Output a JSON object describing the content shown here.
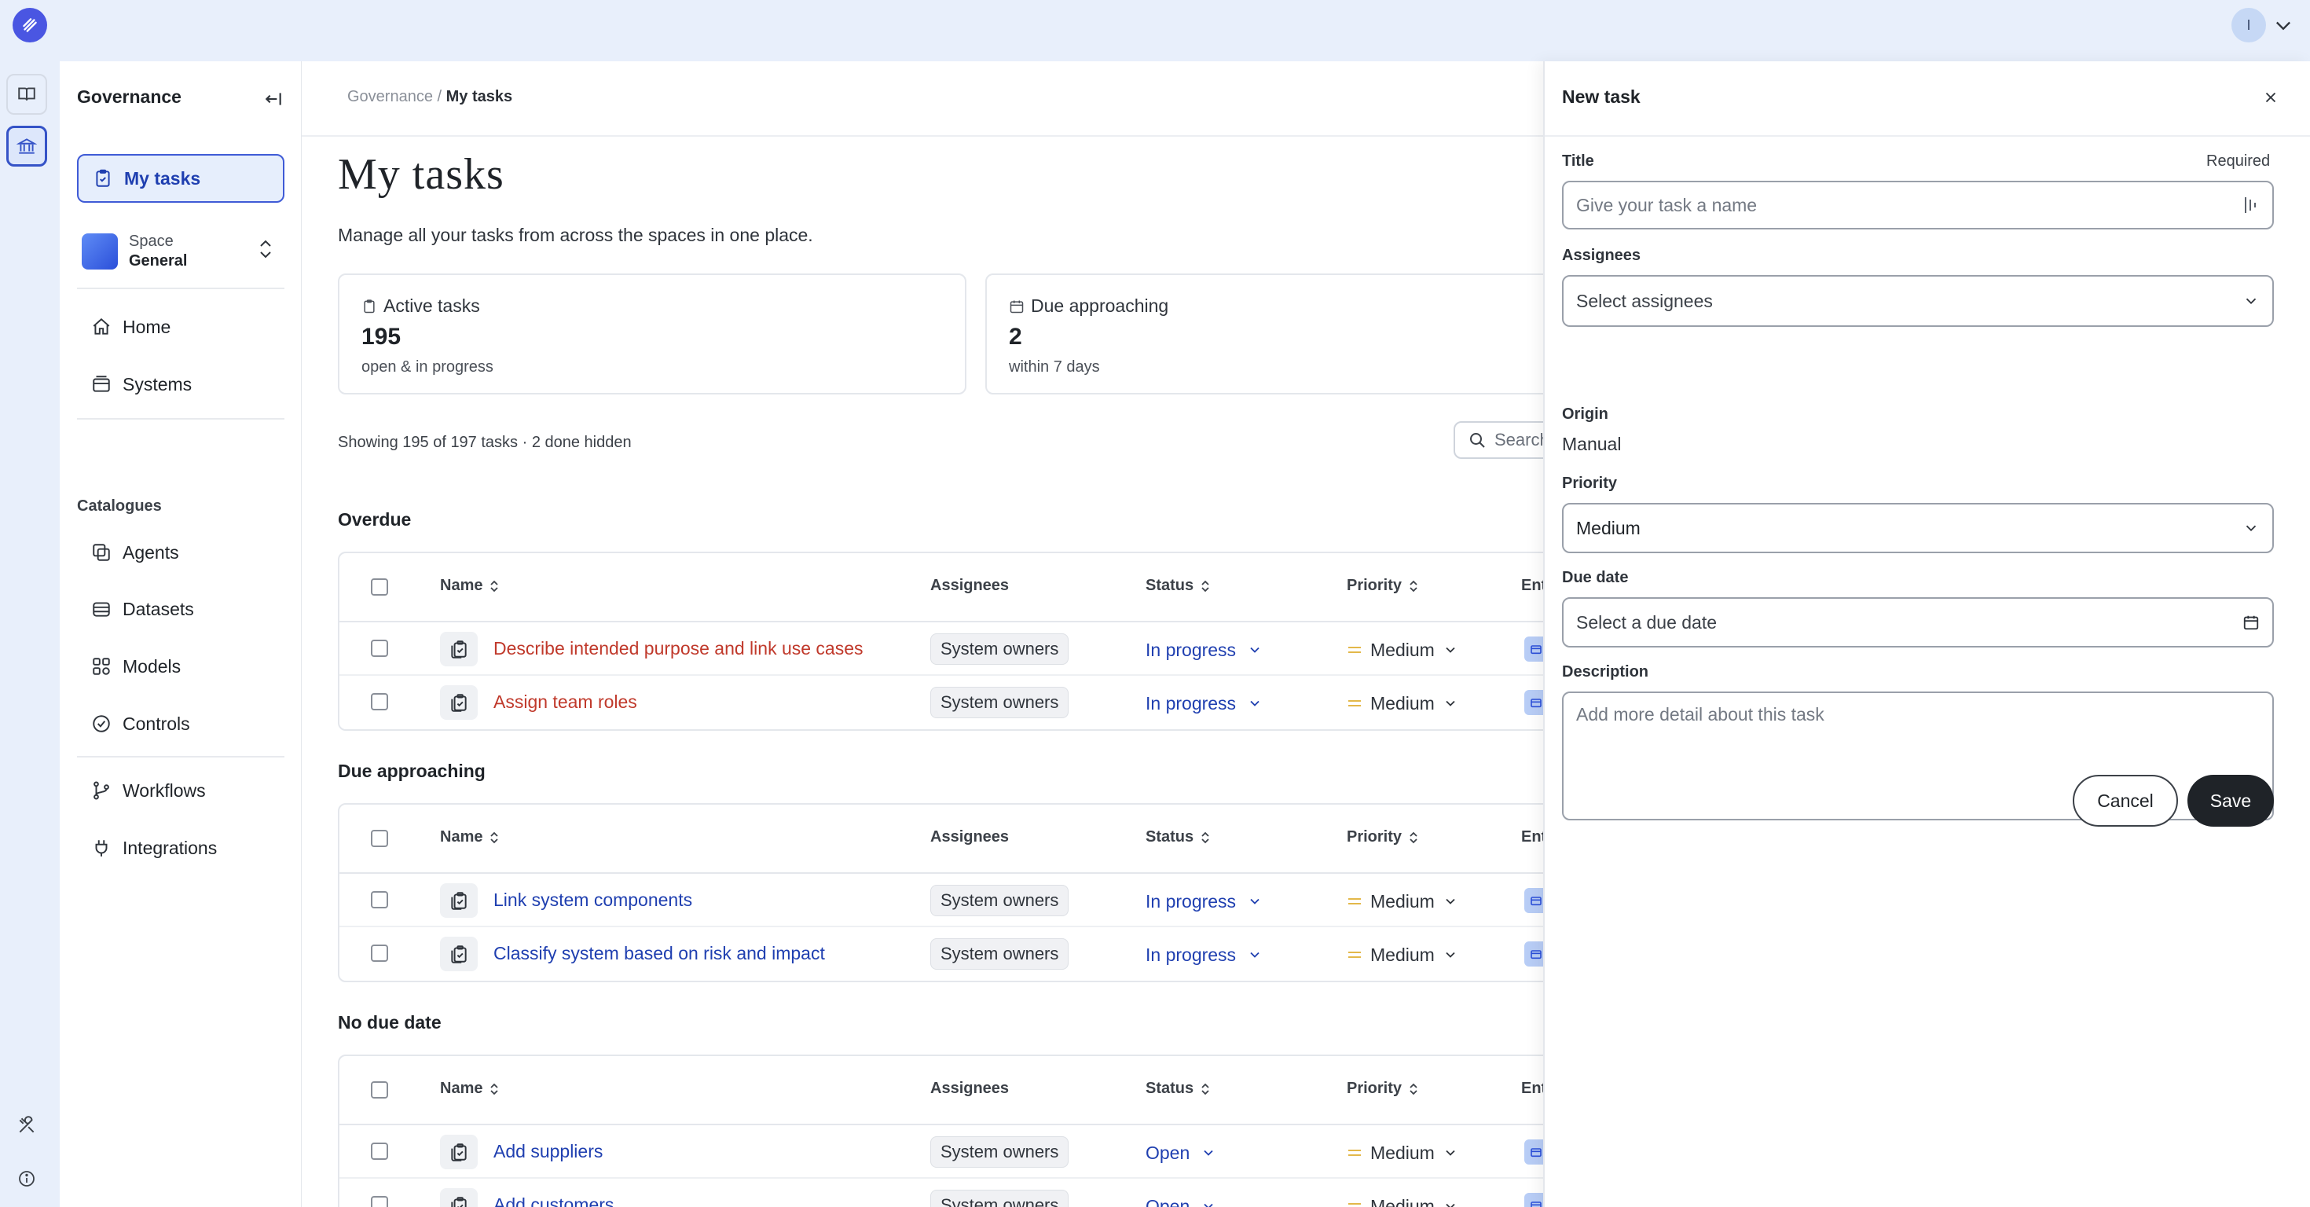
{
  "user": {
    "avatar_initial": "I"
  },
  "sidebar": {
    "title": "Governance",
    "my_tasks_label": "My tasks",
    "space": {
      "label": "Space",
      "name": "General"
    },
    "nav": {
      "home": "Home",
      "systems": "Systems",
      "catalogues_heading": "Catalogues",
      "agents": "Agents",
      "datasets": "Datasets",
      "models": "Models",
      "controls": "Controls",
      "workflows": "Workflows",
      "integrations": "Integrations"
    }
  },
  "main": {
    "breadcrumb": {
      "parent": "Governance",
      "separator": " / ",
      "current": "My tasks"
    },
    "title": "My tasks",
    "description": "Manage all your tasks from across the spaces in one place.",
    "stats": [
      {
        "label": "Active tasks",
        "value": "195",
        "sub": "open & in progress"
      },
      {
        "label": "Due approaching",
        "value": "2",
        "sub": "within 7 days"
      }
    ],
    "showing_text": "Showing 195 of 197 tasks · 2 done hidden",
    "search_placeholder": "Search",
    "columns": {
      "name": "Name",
      "assignees": "Assignees",
      "status": "Status",
      "priority": "Priority",
      "entity": "Ent"
    },
    "groups": [
      {
        "title": "Overdue",
        "rows": [
          {
            "name": "Describe intended purpose and link use cases",
            "assignee": "System owners",
            "status": "In progress",
            "priority": "Medium"
          },
          {
            "name": "Assign team roles",
            "assignee": "System owners",
            "status": "In progress",
            "priority": "Medium"
          }
        ]
      },
      {
        "title": "Due approaching",
        "rows": [
          {
            "name": "Link system components",
            "assignee": "System owners",
            "status": "In progress",
            "priority": "Medium"
          },
          {
            "name": "Classify system based on risk and impact",
            "assignee": "System owners",
            "status": "In progress",
            "priority": "Medium"
          }
        ]
      },
      {
        "title": "No due date",
        "rows": [
          {
            "name": "Add suppliers",
            "assignee": "System owners",
            "status": "Open",
            "priority": "Medium"
          },
          {
            "name": "Add customers",
            "assignee": "System owners",
            "status": "Open",
            "priority": "Medium"
          }
        ]
      }
    ]
  },
  "drawer": {
    "title": "New task",
    "title_label": "Title",
    "required_label": "Required",
    "title_placeholder": "Give your task a name",
    "assignees_label": "Assignees",
    "assignees_placeholder": "Select assignees",
    "origin_label": "Origin",
    "origin_value": "Manual",
    "priority_label": "Priority",
    "priority_value": "Medium",
    "due_label": "Due date",
    "due_placeholder": "Select a due date",
    "description_label": "Description",
    "description_placeholder": "Add more detail about this task",
    "cancel_label": "Cancel",
    "save_label": "Save"
  },
  "colors": {
    "accent": "#3f5bd6",
    "overdue": "#c0392b",
    "link": "#1f3fb0",
    "priority_medium": "#e3b84a"
  }
}
